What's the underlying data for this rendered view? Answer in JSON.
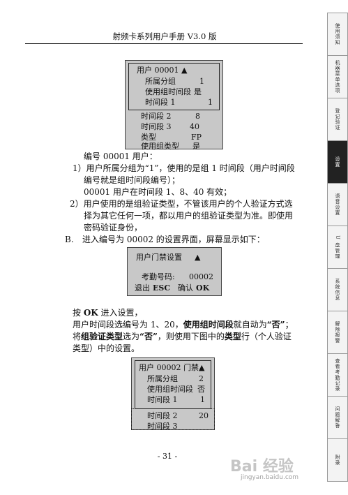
{
  "header": {
    "title": "射频卡系列用户手册 V3.0 版"
  },
  "side_tabs": [
    {
      "label": "使用须知",
      "active": false
    },
    {
      "label": "机器菜单选项",
      "active": false
    },
    {
      "label": "登记验证",
      "active": false
    },
    {
      "label": "设置",
      "active": true
    },
    {
      "label": "语音设置",
      "active": false
    },
    {
      "label": "U 盘管理",
      "active": false
    },
    {
      "label": "系统信息",
      "active": false
    },
    {
      "label": "解除报警",
      "active": false
    },
    {
      "label": "查看考勤记录",
      "active": false
    },
    {
      "label": "问题解答",
      "active": false
    },
    {
      "label": "附录",
      "active": false
    }
  ],
  "screen1": {
    "title": "用户 00001",
    "arrow": "▲",
    "rows": [
      {
        "label": "所属分组",
        "value": "1"
      },
      {
        "label": "使用组时间段",
        "value": "是"
      },
      {
        "label": "时间段 1",
        "value": "1"
      },
      {
        "label": "时间段 2",
        "value": "8"
      },
      {
        "label": "时间段 3",
        "value": "40"
      },
      {
        "label": "类型",
        "value": "FP"
      },
      {
        "label": "使用组类型",
        "value": "是"
      }
    ]
  },
  "text1": {
    "line1": "编号 00001 用户：",
    "line2": "1）用户所属分组为“1”，使用的是组 1 时间段（用户时间段",
    "line3": "编号就是组时间段编号）；",
    "line4": "00001 用户在时间段 1、8、40 有效；",
    "line5": "2）用户使用的是组验证类型，不管该用户的个人验证方式选",
    "line6": "择为其它任何一项，都以用户的组验证类型为准。即使用",
    "line7": "密码验证身份，",
    "b_marker": "B.",
    "b_text": "进入编号为 00002 的设置界面，屏幕显示如下："
  },
  "screen2": {
    "title": "用户门禁设置",
    "arrow": "▲",
    "id_label": "考勤号码:",
    "id_value": "00002",
    "exit_label": "退出",
    "exit_key": "ESC",
    "ok_label": "确认",
    "ok_key": "OK"
  },
  "text2": {
    "a1": "按 ",
    "a2": "OK",
    "a3": " 进入设置，",
    "b1": "用户时间段选编号为 1、20，",
    "b2": "使用组时间段",
    "b3": "就自动为",
    "b4": "“否”",
    "b5": "；",
    "c1": "将",
    "c2": "组验证类型",
    "c3": "选为",
    "c4": "“否”",
    "c5": "，则使用下图中的",
    "c6": "类型",
    "c7": "行（个人验证",
    "d1": "类型）中的设置。"
  },
  "screen3": {
    "title": "用户 00002 门禁",
    "arrow": "▲",
    "rows": [
      {
        "label": "所属分组",
        "value": "2"
      },
      {
        "label": "使用组时间段",
        "value": "否"
      },
      {
        "label": "时间段 1",
        "value": "1"
      },
      {
        "label": "时间段 2",
        "value": "20"
      },
      {
        "label": "时间段 3",
        "value": ""
      }
    ]
  },
  "footer": {
    "page": "- 31 -"
  },
  "watermark": {
    "brand": "Bai 经验",
    "url": "jingyan.baidu.com"
  }
}
